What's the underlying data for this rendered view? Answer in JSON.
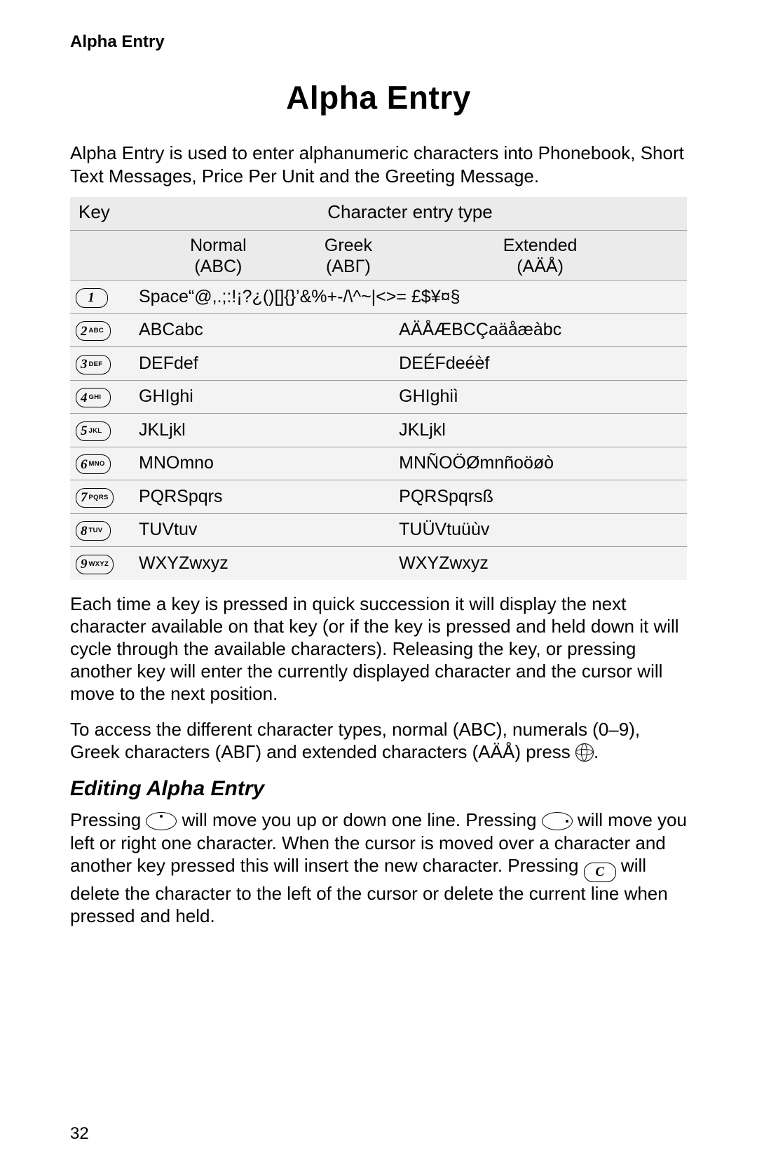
{
  "page": {
    "running_head": "Alpha Entry",
    "title": "Alpha Entry",
    "page_number": "32"
  },
  "intro": "Alpha Entry is used to enter alphanumeric characters into Phonebook, Short Text Messages, Price Per Unit and the Greeting Message.",
  "table": {
    "header": {
      "key": "Key",
      "type": "Character entry type",
      "cols": [
        {
          "name": "Normal",
          "sub": "(ABC)"
        },
        {
          "name": "Greek",
          "sub": "(ΑΒΓ)"
        },
        {
          "name": "Extended",
          "sub": "(AÄÅ)"
        }
      ]
    },
    "rows": [
      {
        "digit": "1",
        "letters": "",
        "full": "Space“@,.;:!¡?¿()[]{}’&%+-/\\^~|<>=  £$¥¤§"
      },
      {
        "digit": "2",
        "letters": "ABC",
        "normal": "ABCabc",
        "extended": "AÄÅÆBCÇaäåæàbc"
      },
      {
        "digit": "3",
        "letters": "DEF",
        "normal": "DEFdef",
        "extended": "DEÉFdeéèf"
      },
      {
        "digit": "4",
        "letters": "GHI",
        "normal": "GHIghi",
        "extended": "GHIghiì"
      },
      {
        "digit": "5",
        "letters": "JKL",
        "normal": "JKLjkl",
        "extended": "JKLjkl"
      },
      {
        "digit": "6",
        "letters": "MNO",
        "normal": "MNOmno",
        "extended": "MNÑOÖØmnñoöøò"
      },
      {
        "digit": "7",
        "letters": "PQRS",
        "normal": "PQRSpqrs",
        "extended": "PQRSpqrsß"
      },
      {
        "digit": "8",
        "letters": "TUV",
        "normal": "TUVtuv",
        "extended": "TUÜVtuüùv"
      },
      {
        "digit": "9",
        "letters": "WXYZ",
        "normal": "WXYZwxyz",
        "extended": "WXYZwxyz"
      }
    ]
  },
  "para1": "Each time a key is pressed in quick succession it will display the next character available on that key (or if the key is pressed and held down it will cycle through the available characters). Releasing the key, or pressing another key will enter the currently displayed character and the cursor will move to the next position.",
  "para2": {
    "pre": "To access the different character types, normal (",
    "abc": "ABC",
    "mid1": "), numerals (",
    "nums": "0–9",
    "mid2": "), Greek characters (",
    "greek": "ΑΒΓ",
    "mid3": ") and extended characters (",
    "ext": "AÄÅ",
    "mid4": ") press ",
    "end": "."
  },
  "subhead": "Editing Alpha Entry",
  "para3": {
    "a": "Pressing ",
    "b": " will move you up or down one line. Pressing ",
    "c": " will move you left or right one character. When the cursor is moved over a character and another key pressed this will insert the new character. Pressing ",
    "c_key": "C",
    "d": " will delete the character to the left of the cursor or delete the current line when pressed and held."
  }
}
